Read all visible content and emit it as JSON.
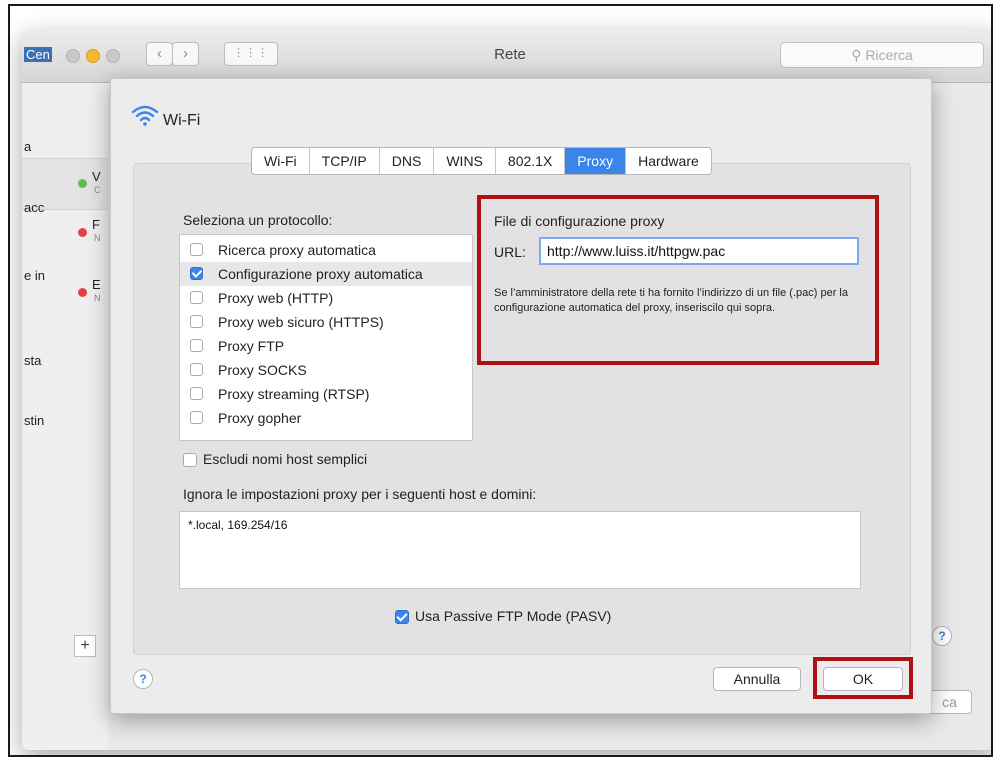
{
  "window": {
    "title": "Rete",
    "search_placeholder": "Ricerca",
    "traffic_colors": [
      "#c9c9c9",
      "#f5b82e",
      "#c9c9c9"
    ]
  },
  "background_sidebar": {
    "fragments": [
      "Cen",
      "a",
      "acc",
      "e in",
      "sta",
      "stin"
    ],
    "items": [
      {
        "letter": "V",
        "sub": "C",
        "dot": "#5cbf4a"
      },
      {
        "letter": "F",
        "sub": "N",
        "dot": "#e0443e"
      },
      {
        "letter": "E",
        "sub": "N",
        "dot": "#e0443e"
      }
    ],
    "add_label": "+",
    "help_label": "?",
    "partial_button": "ca"
  },
  "sheet": {
    "interface_name": "Wi-Fi",
    "tabs": [
      {
        "label": "Wi-Fi",
        "active": false
      },
      {
        "label": "TCP/IP",
        "active": false
      },
      {
        "label": "DNS",
        "active": false
      },
      {
        "label": "WINS",
        "active": false
      },
      {
        "label": "802.1X",
        "active": false
      },
      {
        "label": "Proxy",
        "active": true
      },
      {
        "label": "Hardware",
        "active": false
      }
    ],
    "protocols_title": "Seleziona un protocollo:",
    "protocols": [
      {
        "label": "Ricerca proxy automatica",
        "checked": false,
        "selected": false
      },
      {
        "label": "Configurazione proxy automatica",
        "checked": true,
        "selected": true
      },
      {
        "label": "Proxy web (HTTP)",
        "checked": false,
        "selected": false
      },
      {
        "label": "Proxy web sicuro (HTTPS)",
        "checked": false,
        "selected": false
      },
      {
        "label": "Proxy FTP",
        "checked": false,
        "selected": false
      },
      {
        "label": "Proxy SOCKS",
        "checked": false,
        "selected": false
      },
      {
        "label": "Proxy streaming (RTSP)",
        "checked": false,
        "selected": false
      },
      {
        "label": "Proxy gopher",
        "checked": false,
        "selected": false
      }
    ],
    "config": {
      "title": "File di configurazione proxy",
      "url_label": "URL:",
      "url_value": "http://www.luiss.it/httpgw.pac",
      "help_text": "Se l’amministratore della rete ti ha fornito l’indirizzo di un file (.pac) per la configurazione automatica del proxy, inseriscilo qui sopra."
    },
    "exclude_simple_hosts": {
      "label": "Escludi nomi host semplici",
      "checked": false
    },
    "bypass_title": "Ignora le impostazioni proxy per i seguenti host e domini:",
    "bypass_value": "*.local, 169.254/16",
    "pasv": {
      "label": "Usa Passive FTP Mode (PASV)",
      "checked": true
    },
    "help_label": "?",
    "cancel_label": "Annulla",
    "ok_label": "OK"
  },
  "colors": {
    "accent": "#3b85ea",
    "highlight_red": "#b00f14"
  }
}
